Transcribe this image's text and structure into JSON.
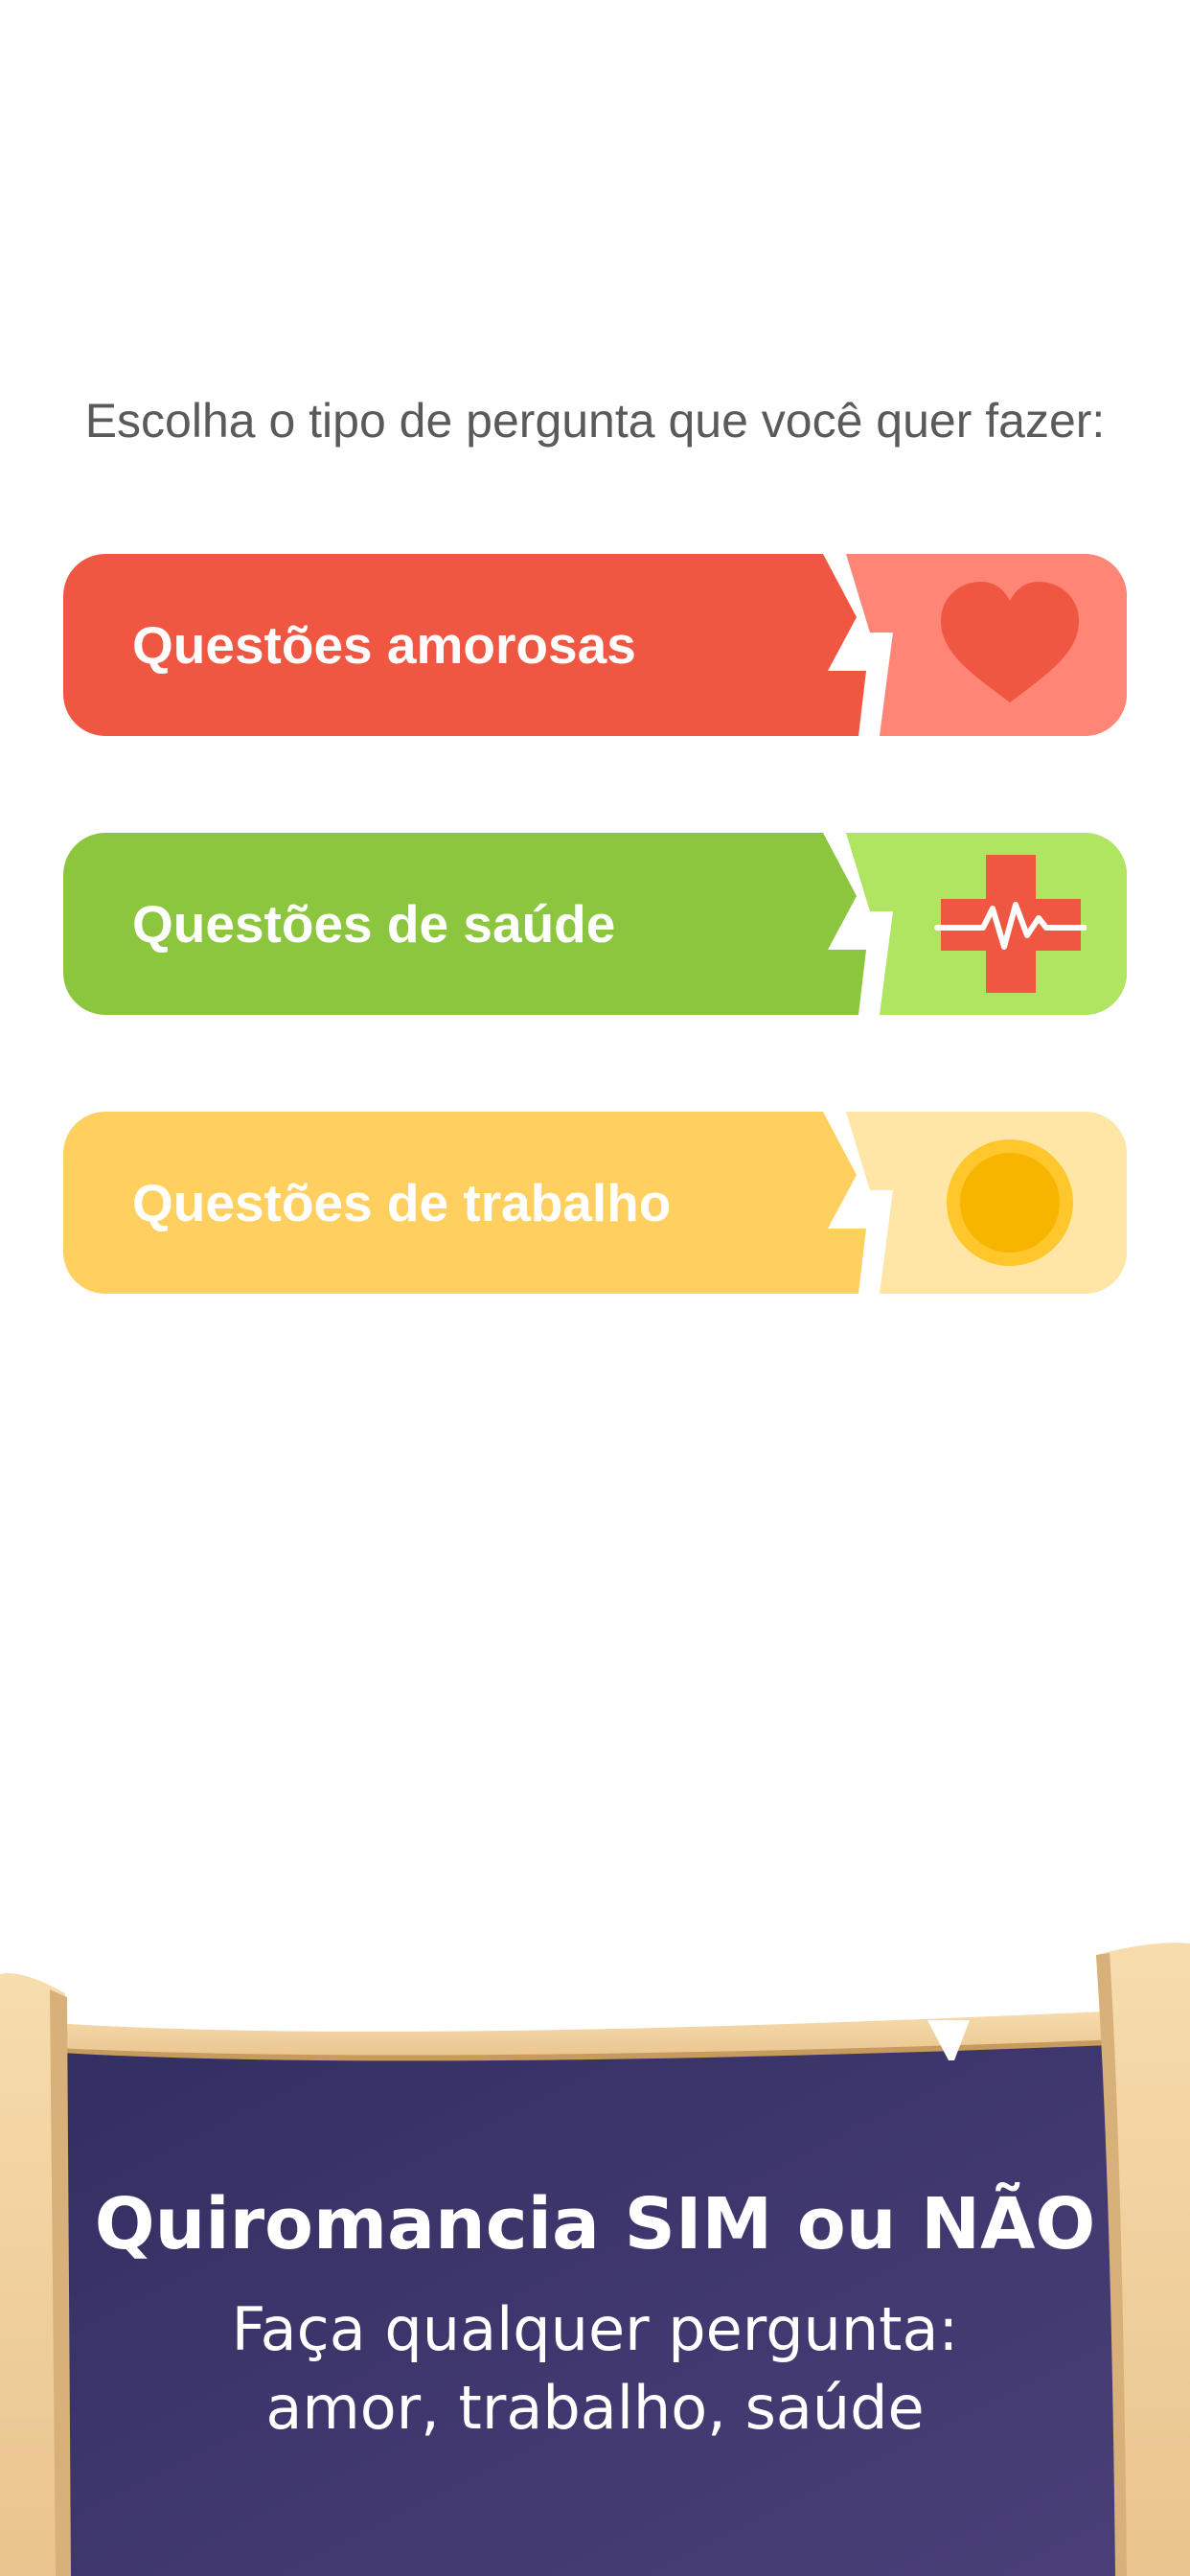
{
  "prompt": "Escolha o tipo de pergunta que você quer fazer:",
  "categories": [
    {
      "label": "Questões amorosas",
      "icon": "heart-icon",
      "main_color": "#f05742",
      "side_color": "#ff8577",
      "icon_color": "#f05742"
    },
    {
      "label": "Questões de saúde",
      "icon": "medical-cross-heartbeat-icon",
      "main_color": "#8cc63f",
      "side_color": "#b0e561",
      "icon_color": "#f05742"
    },
    {
      "label": "Questões de trabalho",
      "icon": "coin-icon",
      "main_color": "#ffd05f",
      "side_color": "#ffe6a6",
      "icon_color": "#f7b500"
    }
  ],
  "banner": {
    "title": "Quiromancia SIM ou NÃO",
    "subtitle_line1": "Faça qualquer pergunta:",
    "subtitle_line2": "amor, trabalho, saúde",
    "background_color": "#3b3569",
    "scroll_color": "#f3d3a3"
  }
}
